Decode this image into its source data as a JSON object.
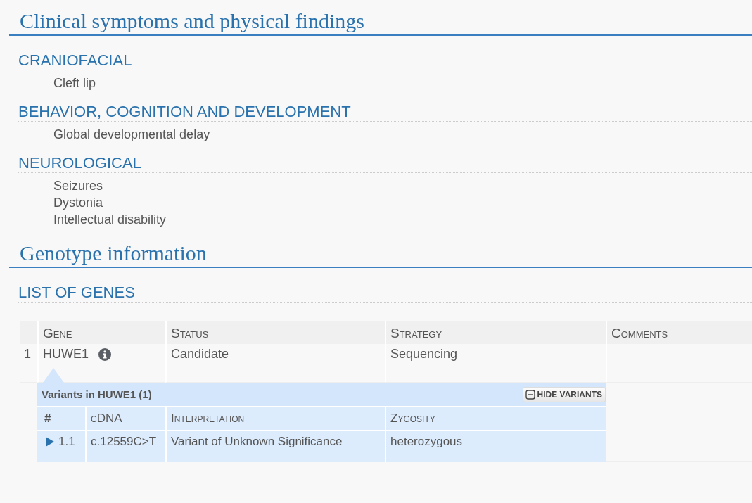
{
  "sections": [
    {
      "title": "Clinical symptoms and physical findings",
      "categories": [
        {
          "name": "CRANIOFACIAL",
          "items": [
            "Cleft lip"
          ]
        },
        {
          "name": "BEHAVIOR, COGNITION AND DEVELOPMENT",
          "items": [
            "Global developmental delay"
          ]
        },
        {
          "name": "NEUROLOGICAL",
          "items": [
            "Seizures",
            "Dystonia",
            "Intellectual disability"
          ]
        }
      ]
    },
    {
      "title": "Genotype information",
      "categories": [
        {
          "name": "LIST OF GENES",
          "table": {
            "columns": [
              "Gene",
              "Status",
              "Strategy",
              "Comments"
            ],
            "rows": [
              {
                "index": "1",
                "gene": "HUWE1",
                "status": "Candidate",
                "strategy": "Sequencing",
                "variants": {
                  "title": "Variants in HUWE1 (1)",
                  "button": "HIDE VARIANTS",
                  "expanded": true,
                  "columns": [
                    "#",
                    "cDNA",
                    "Interpretation",
                    "Zygosity"
                  ],
                  "rows": [
                    {
                      "index": "1.1",
                      "cdna": "c.12559C>T",
                      "interpretation": "Variant of Unknown Significance",
                      "zygosity": "heterozygous"
                    }
                  ]
                }
              }
            ]
          }
        }
      ]
    }
  ]
}
